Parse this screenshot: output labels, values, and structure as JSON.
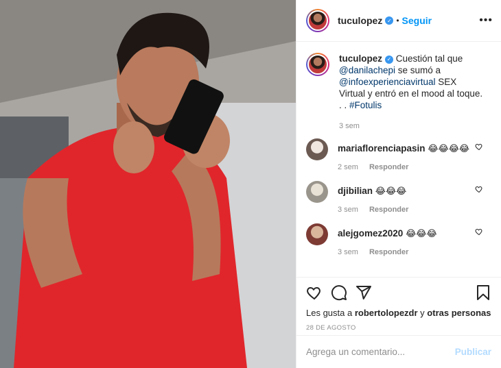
{
  "post": {
    "username": "tuculopez",
    "follow_label": "Seguir",
    "more_label": "•••",
    "separator": "•"
  },
  "caption": {
    "username": "tuculopez",
    "text_1": " Cuestión tal que ",
    "mention_1": "@danilachepi",
    "text_2": " se sumó a ",
    "mention_2": "@infoexperienciavirtual",
    "text_3": " SEX Virtual y entró en el mood al toque. . . ",
    "hashtag": "#Fotulis",
    "time": "3 sem"
  },
  "comments": [
    {
      "username": "mariaflorenciapasin",
      "text": "😂😂😂😂",
      "time": "2 sem",
      "reply": "Responder"
    },
    {
      "username": "djibilian",
      "text": "😂😂😂",
      "time": "3 sem",
      "reply": "Responder"
    },
    {
      "username": "alejgomez2020",
      "text": "😂😂😂",
      "time": "3 sem",
      "reply": "Responder"
    }
  ],
  "likes": {
    "prefix": "Les gusta a ",
    "user": "robertolopezdr",
    "middle": " y ",
    "others": "otras personas"
  },
  "date": "28 DE AGOSTO",
  "add_comment": {
    "placeholder": "Agrega un comentario...",
    "publish_label": "Publicar"
  },
  "icons": [
    "heart-icon",
    "comment-icon",
    "share-icon",
    "bookmark-icon",
    "verified-icon"
  ],
  "colors": {
    "accent": "#0095f6",
    "mention": "#00376b",
    "muted": "#8e8e8e",
    "publish_disabled": "#b3dbff"
  }
}
